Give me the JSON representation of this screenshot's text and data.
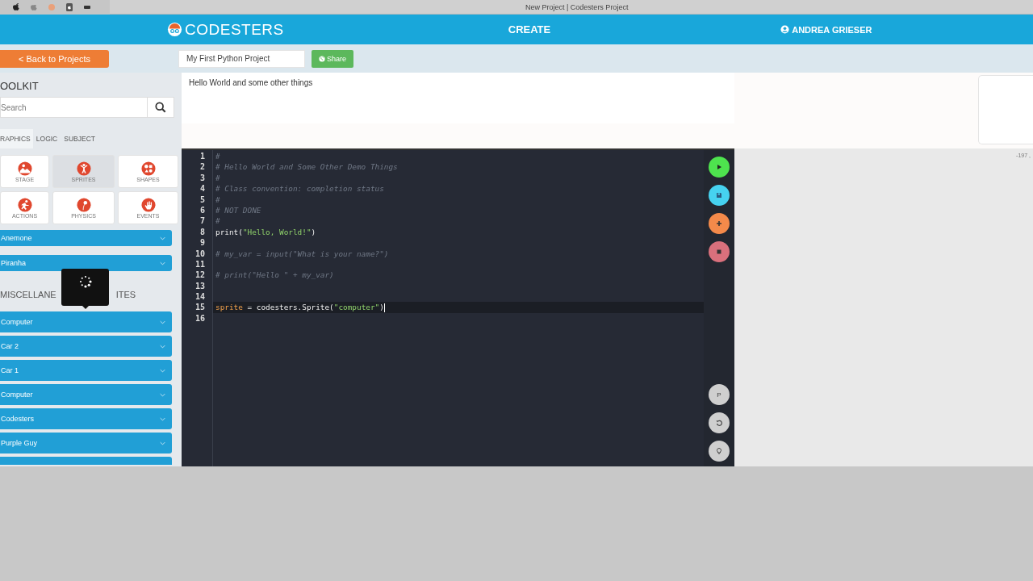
{
  "window": {
    "title": "New Project | Codesters Project"
  },
  "header": {
    "logo": "CODESTERS",
    "section": "CREATE",
    "user": "ANDREA GRIESER"
  },
  "toolbar": {
    "back_button": "< Back to Projects",
    "project_name": "My First Python Project",
    "share_button": "Share"
  },
  "toolkit": {
    "title": "OOLKIT",
    "search": {
      "placeholder": "Search"
    },
    "tabs": [
      {
        "label": "RAPHICS",
        "selected": true
      },
      {
        "label": "LOGIC",
        "selected": false
      },
      {
        "label": "SUBJECT",
        "selected": false
      }
    ],
    "categories": [
      {
        "label": "STAGE",
        "selected": false,
        "kind": "stage"
      },
      {
        "label": "SPRITES",
        "selected": true,
        "kind": "sprites"
      },
      {
        "label": "SHAPES",
        "selected": false,
        "kind": "shapes"
      },
      {
        "label": "ACTIONS",
        "selected": false,
        "kind": "actions"
      },
      {
        "label": "PHYSICS",
        "selected": false,
        "kind": "physics"
      },
      {
        "label": "EVENTS",
        "selected": false,
        "kind": "events"
      }
    ],
    "items_top": [
      "Anemone",
      "Piranha"
    ],
    "heading_parts": [
      "MISCELLANE",
      "ITES"
    ],
    "items": [
      "Computer",
      "Car 2",
      "Car 1",
      "Computer",
      "Codesters",
      "Purple Guy"
    ]
  },
  "description": "Hello World and some other things",
  "editor": {
    "lines": [
      {
        "number": "1",
        "active": false,
        "tokens": [
          {
            "kind": "comment",
            "text": "#"
          }
        ]
      },
      {
        "number": "2",
        "active": false,
        "tokens": [
          {
            "kind": "comment",
            "text": "# Hello World and Some Other Demo Things"
          }
        ]
      },
      {
        "number": "3",
        "active": false,
        "tokens": [
          {
            "kind": "comment",
            "text": "#"
          }
        ]
      },
      {
        "number": "4",
        "active": false,
        "tokens": [
          {
            "kind": "comment",
            "text": "# Class convention: completion status"
          }
        ]
      },
      {
        "number": "5",
        "active": false,
        "tokens": [
          {
            "kind": "comment",
            "text": "#"
          }
        ]
      },
      {
        "number": "6",
        "active": false,
        "tokens": [
          {
            "kind": "comment",
            "text": "# NOT DONE"
          }
        ]
      },
      {
        "number": "7",
        "active": false,
        "tokens": [
          {
            "kind": "comment",
            "text": "#"
          }
        ]
      },
      {
        "number": "8",
        "active": false,
        "tokens": [
          {
            "kind": "plain",
            "text": "print("
          },
          {
            "kind": "string",
            "text": "\"Hello, World!\""
          },
          {
            "kind": "plain",
            "text": ")"
          }
        ]
      },
      {
        "number": "9",
        "active": false
      },
      {
        "number": "10",
        "active": false,
        "tokens": [
          {
            "kind": "comment",
            "text": "# my_var = input(\"What is your name?\")"
          }
        ]
      },
      {
        "number": "11",
        "active": false
      },
      {
        "number": "12",
        "active": false,
        "tokens": [
          {
            "kind": "comment",
            "text": "# print(\"Hello \" + my_var)"
          }
        ]
      },
      {
        "number": "13",
        "active": false
      },
      {
        "number": "14",
        "active": false
      },
      {
        "number": "15",
        "active": true,
        "tokens": [
          {
            "kind": "variable",
            "text": "sprite"
          },
          {
            "kind": "plain",
            "text": " = codesters.Sprite("
          },
          {
            "kind": "string",
            "text": "\"computer\""
          },
          {
            "kind": "plain",
            "text": ")"
          }
        ]
      },
      {
        "number": "16",
        "active": false
      }
    ],
    "controls_top": [
      {
        "kind": "run"
      },
      {
        "kind": "save"
      },
      {
        "kind": "add"
      },
      {
        "kind": "stop"
      }
    ],
    "controls_bottom": [
      {
        "kind": "p",
        "text": "P"
      },
      {
        "kind": "undo"
      },
      {
        "kind": "hint"
      }
    ]
  },
  "stage": {
    "coordinates": "-197 ,"
  }
}
